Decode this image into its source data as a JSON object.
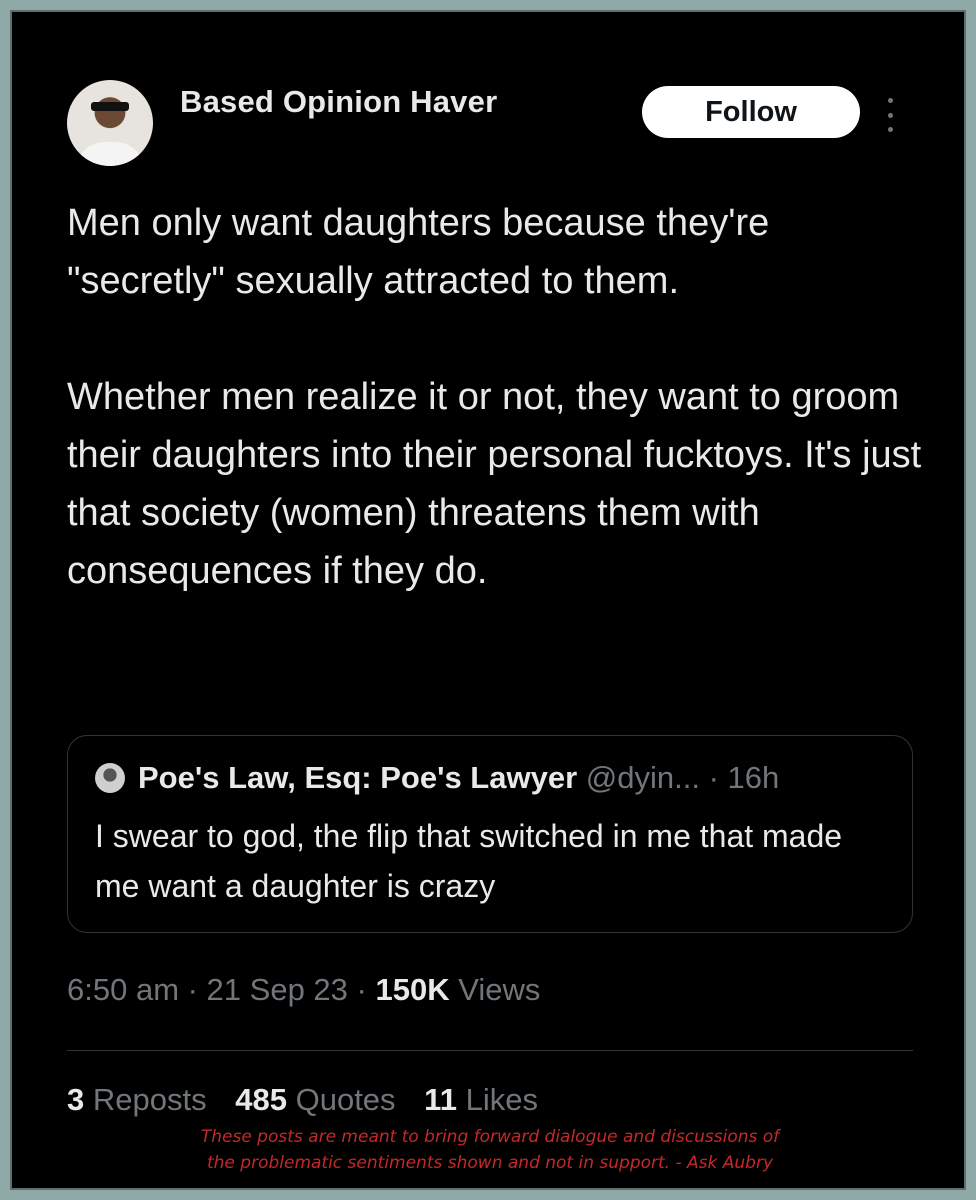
{
  "author": {
    "name": "Based Opinion Haver"
  },
  "follow_label": "Follow",
  "post": {
    "paragraphs": [
      "Men only want daughters because they're \"secretly\" sexually attracted to them.",
      "Whether men realize it or not, they want to groom their daughters into their personal fucktoys. It's just that society (women) threatens them with consequences if they do."
    ]
  },
  "quote": {
    "name": "Poe's Law, Esq: Poe's Lawyer",
    "handle": "@dyin...",
    "time": "· 16h",
    "text": "I swear to god, the flip that switched in me that made me want a daughter is crazy"
  },
  "meta": {
    "time_date": "6:50 am · 21 Sep 23 ·",
    "views_count": "150K",
    "views_label": "Views"
  },
  "stats": {
    "reposts_count": "3",
    "reposts_label": "Reposts",
    "quotes_count": "485",
    "quotes_label": "Quotes",
    "likes_count": "11",
    "likes_label": "Likes"
  },
  "disclaimer": {
    "line1": "These posts are meant to bring forward dialogue and discussions of",
    "line2": "the problematic sentiments shown and not in support. - Ask Aubry"
  },
  "icons": {
    "more": "more-vertical-icon",
    "avatar": "user-avatar"
  },
  "colors": {
    "background": "#000000",
    "text": "#e7e9ea",
    "muted": "#71767b",
    "border": "#2f3336",
    "frame": "#8fa8a8",
    "disclaimer": "#c62828"
  }
}
